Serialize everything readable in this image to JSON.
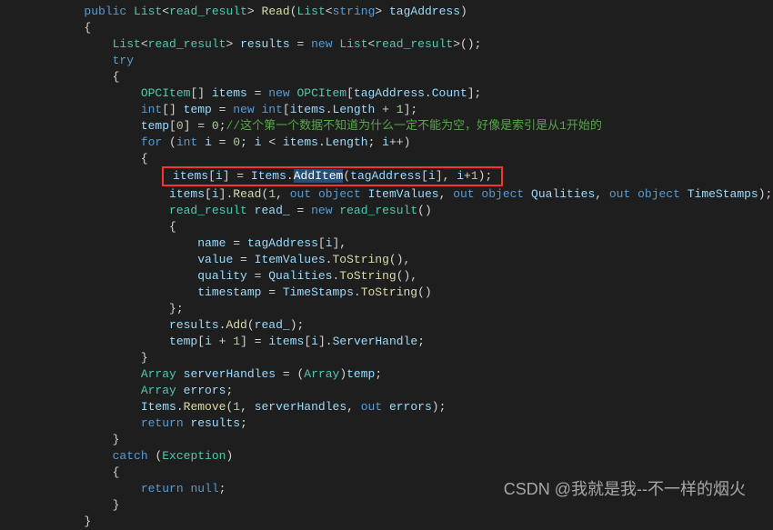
{
  "code": {
    "l1": {
      "public": "public",
      "list": "List",
      "read_result": "read_result",
      "method": "Read",
      "list2": "List",
      "string": "string",
      "param": "tagAddress"
    },
    "l4": {
      "list": "List",
      "read_result": "read_result",
      "var": "results",
      "new": "new",
      "list2": "List",
      "read_result2": "read_result"
    },
    "l5": {
      "try": "try"
    },
    "l7": {
      "type": "OPCItem",
      "var": "items",
      "new": "new",
      "type2": "OPCItem",
      "param": "tagAddress",
      "prop": "Count"
    },
    "l8": {
      "int": "int",
      "var": "temp",
      "new": "new",
      "int2": "int",
      "items": "items",
      "prop": "Length",
      "plus": "1"
    },
    "l9": {
      "var": "temp",
      "idx": "0",
      "val": "0",
      "comment": "//这个第一个数据不知道为什么一定不能为空，好像是索引是从1开始的"
    },
    "l10": {
      "for": "for",
      "int": "int",
      "i": "i",
      "zero": "0",
      "i2": "i",
      "items": "items",
      "prop": "Length",
      "i3": "i"
    },
    "l12": {
      "items": "items",
      "i": "i",
      "Items": "Items",
      "method": "AddItem",
      "param": "tagAddress",
      "i2": "i",
      "i3": "i",
      "plus": "1"
    },
    "l13": {
      "items": "items",
      "i": "i",
      "method": "Read",
      "one": "1",
      "out1": "out",
      "obj1": "object",
      "v1": "ItemValues",
      "out2": "out",
      "obj2": "object",
      "v2": "Qualities",
      "out3": "out",
      "obj3": "object",
      "v3": "TimeStamps"
    },
    "l14": {
      "type": "read_result",
      "var": "read_",
      "new": "new",
      "type2": "read_result"
    },
    "l16": {
      "name": "name",
      "param": "tagAddress",
      "i": "i"
    },
    "l17": {
      "name": "value",
      "var": "ItemValues",
      "method": "ToString"
    },
    "l18": {
      "name": "quality",
      "var": "Qualities",
      "method": "ToString"
    },
    "l19": {
      "name": "timestamp",
      "var": "TimeStamps",
      "method": "ToString"
    },
    "l21": {
      "var": "results",
      "method": "Add",
      "arg": "read_"
    },
    "l22": {
      "var": "temp",
      "i": "i",
      "one": "1",
      "items": "items",
      "i2": "i",
      "prop": "ServerHandle"
    },
    "l24": {
      "type": "Array",
      "var": "serverHandles",
      "type2": "Array",
      "arg": "temp"
    },
    "l25": {
      "type": "Array",
      "var": "errors"
    },
    "l26": {
      "obj": "Items",
      "method": "Remove",
      "one": "1",
      "arg": "serverHandles",
      "out": "out",
      "err": "errors"
    },
    "l27": {
      "return": "return",
      "var": "results"
    },
    "l29": {
      "catch": "catch",
      "type": "Exception"
    },
    "l31": {
      "return": "return",
      "null": "null"
    }
  },
  "watermark": "CSDN @我就是我--不一样的烟火"
}
